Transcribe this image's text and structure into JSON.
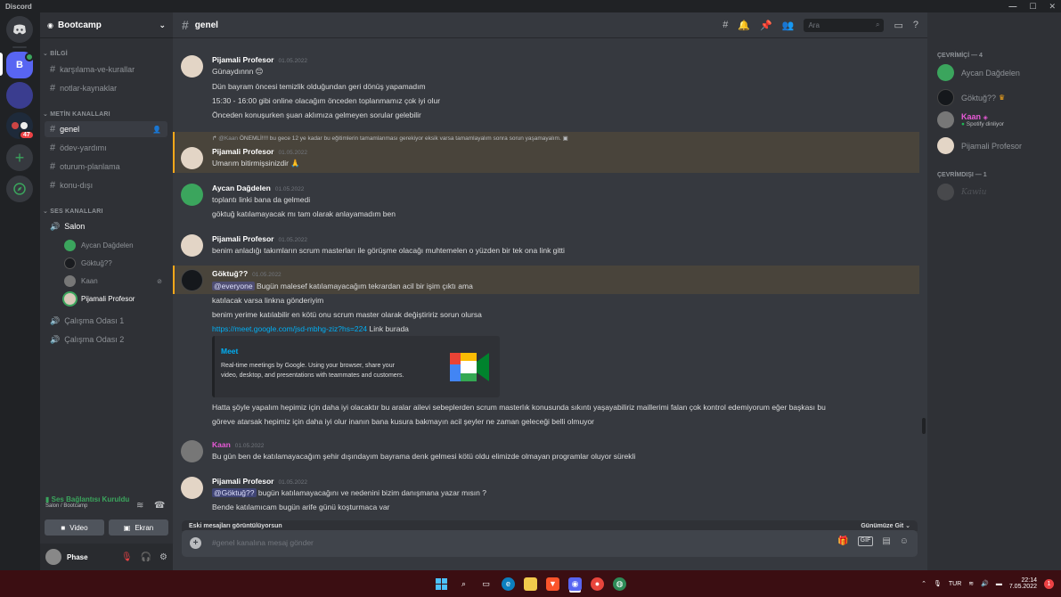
{
  "titlebar": {
    "app": "Discord",
    "minimize": "—",
    "maximize": "☐",
    "close": "✕"
  },
  "guilds": {
    "home_icon": "discord-logo-icon",
    "server_initial": "B",
    "badge_count": "47",
    "add_icon": "plus-icon",
    "explore_icon": "compass-icon"
  },
  "sidebar": {
    "server_name": "Bootcamp",
    "categories": {
      "info": "BİLGİ",
      "text": "METİN KANALLARI",
      "voice": "SES KANALLARI"
    },
    "info_channels": [
      "karşılama-ve-kurallar",
      "notlar-kaynaklar"
    ],
    "text_channels": [
      "genel",
      "ödev-yardımı",
      "oturum-planlama",
      "konu-dışı"
    ],
    "voice_channels": [
      "Salon",
      "Çalışma Odası 1",
      "Çalışma Odası 2"
    ],
    "voice_users": [
      "Aycan Dağdelen",
      "Göktuğ??",
      "Kaan",
      "Pijamali Profesor"
    ],
    "voice_status": "Ses Bağlantısı Kuruldu",
    "voice_location": "Salon / Bootcamp",
    "video_label": "Video",
    "screen_label": "Ekran",
    "username": "Phase"
  },
  "header": {
    "channel": "genel",
    "search_placeholder": "Ara"
  },
  "messages": {
    "m1": {
      "author": "Pijamali Profesor",
      "date": "01.05.2022",
      "lines": [
        "Günaydınnn 😊",
        "Dün bayram öncesi temizlik olduğundan geri dönüş yapamadım",
        "15:30 - 16:00 gibi online olacağım önceden toplanmamız çok iyi olur",
        "Önceden konuşurken şuan aklımıza gelmeyen sorular gelebilir"
      ]
    },
    "reply": {
      "to": "@Kaan",
      "text": "ÖNEMLİ!!!!  bu gece 12 ye kadar bu eğitimlerin tamamlanması gerekiyor eksik varsa tamamlayalım sonra sorun yaşamayalım."
    },
    "m2": {
      "author": "Pijamali Profesor",
      "date": "01.05.2022",
      "lines": [
        "Umarım bitirmişsinizdir 🙏"
      ]
    },
    "m3": {
      "author": "Aycan Dağdelen",
      "date": "01.05.2022",
      "lines": [
        "toplantı linki bana da gelmedi",
        "göktuğ katılamayacak mı tam olarak anlayamadım ben"
      ]
    },
    "m4": {
      "author": "Pijamali Profesor",
      "date": "01.05.2022",
      "lines": [
        "benim anladığı takımların scrum masterları ile görüşme olacağı muhtemelen o yüzden bir tek ona link gitti"
      ]
    },
    "m5": {
      "author": "Göktuğ??",
      "date": "01.05.2022",
      "mention": "@everyone",
      "first": "Bugün malesef katılamayacağım tekrardan acil bir işim çıktı ama",
      "lines": [
        "katılacak varsa linkna gönderiyim",
        "benim yerime katılabilir en kötü onu scrum master olarak değiştiririz sorun olursa"
      ],
      "link": "https://meet.google.com/jsd-mbhg-ziz?hs=224",
      "link_suffix": "Link burada",
      "long1": "Hatta şöyle yapalım hepimiz için daha iyi olacaktır bu aralar ailevi sebeplerden scrum masterlık konusunda sıkıntı yaşayabiliriz maillerimi falan çok kontrol edemiyorum eğer başkası bu",
      "long2": "göreve atarsak hepimiz için daha iyi olur inanın bana kusura bakmayın acil şeyler ne zaman geleceği belli olmuyor"
    },
    "embed": {
      "title": "Meet",
      "desc1": "Real-time meetings by Google. Using your browser, share your",
      "desc2": "video, desktop, and presentations with teammates and customers."
    },
    "m6": {
      "author": "Kaan",
      "date": "01.05.2022",
      "lines": [
        "Bu gün ben de katılamayacağım şehir dışındayım bayrama denk gelmesi kötü oldu elimizde olmayan programlar oluyor sürekli"
      ]
    },
    "m7": {
      "author": "Pijamali Profesor",
      "date": "01.05.2022",
      "mention": "@Göktuğ??",
      "first": "bugün katılamayacağını ve nedenini bizim danışmana yazar mısın ?",
      "lines": [
        "Bende katılamıcam bugün arife günü koşturmaca var"
      ]
    }
  },
  "composer": {
    "older_notice": "Eski mesajları görüntülüyorsun",
    "jump": "Günümüze Git",
    "placeholder": "#genel kanalına mesaj gönder",
    "gif": "GIF"
  },
  "members": {
    "online_header": "ÇEVRİMİÇİ — 4",
    "offline_header": "ÇEVRİMDIŞI — 1",
    "online": [
      "Aycan Dağdelen",
      "Göktuğ??",
      "Kaan",
      "Pijamali Profesor"
    ],
    "kaan_activity": "Spotify dinliyor",
    "offline": [
      "Kawiu"
    ]
  },
  "taskbar": {
    "lang": "TUR",
    "time": "22:14",
    "date": "7.05.2022",
    "notif": "1"
  },
  "colors": {
    "accent": "#5865f2",
    "online": "#3ba55d",
    "kaan": "#e85ad7",
    "highlight": "#faa81a"
  }
}
